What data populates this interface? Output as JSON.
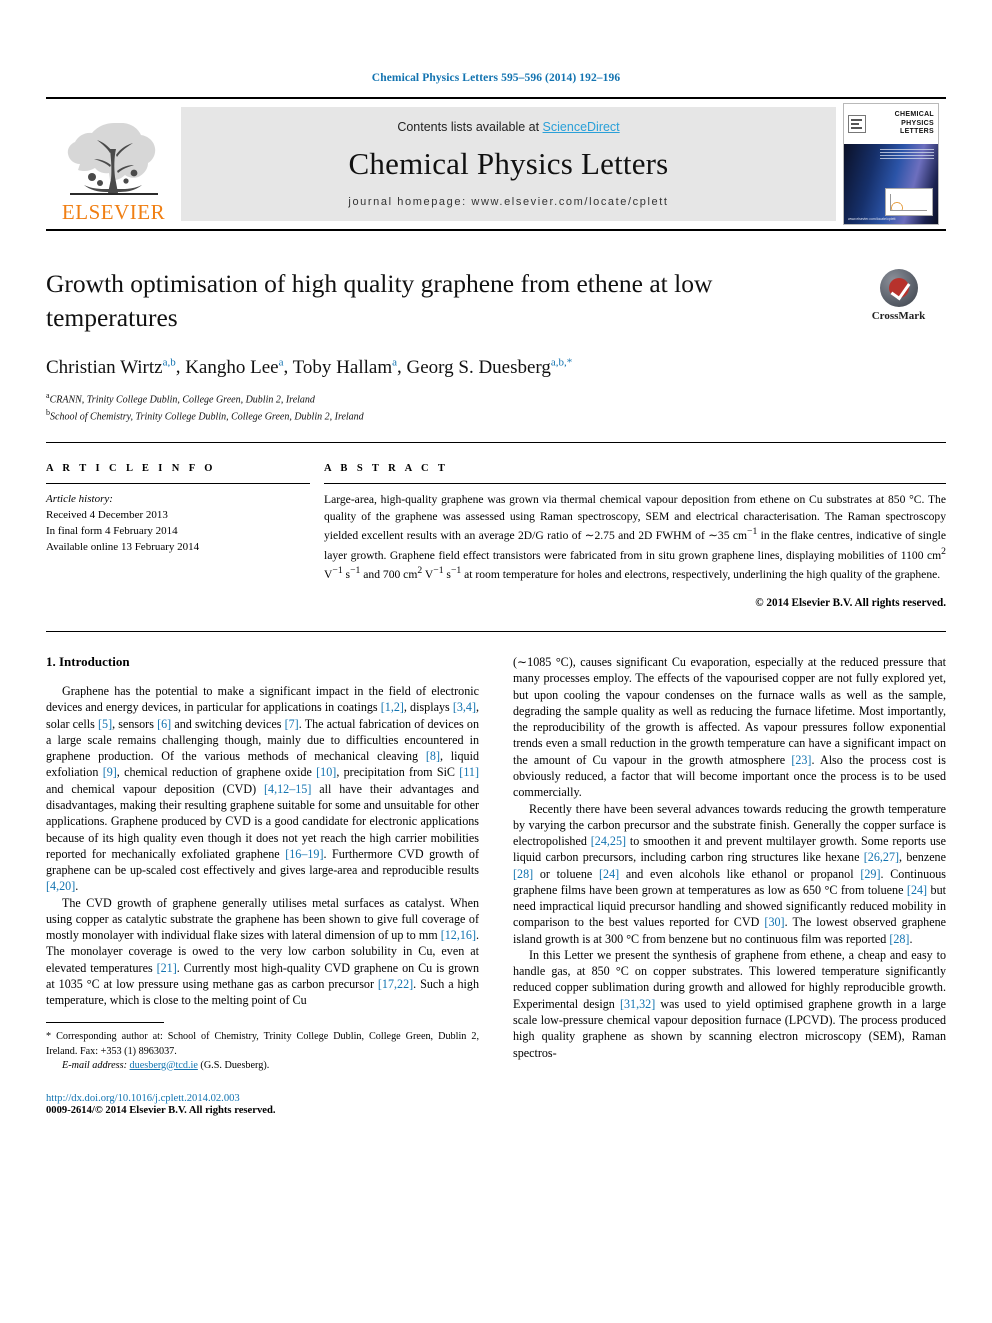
{
  "running_head": "Chemical Physics Letters 595–596 (2014) 192–196",
  "banner": {
    "contents_prefix": "Contents lists available at ",
    "sciencedirect": "ScienceDirect",
    "journal_name": "Chemical Physics Letters",
    "homepage": "journal homepage: www.elsevier.com/locate/cplett",
    "publisher": "ELSEVIER",
    "cover_title": "CHEMICAL PHYSICS LETTERS",
    "cover_footer": "www.elsevier.com/locate/cplett",
    "accent_link_color": "#1273b0",
    "sciencedirect_color": "#2aa0d8",
    "elsevier_orange": "#F07F13"
  },
  "article": {
    "title": "Growth optimisation of high quality graphene from ethene at low temperatures",
    "authors": "Christian Wirtz a,b, Kangho Lee a, Toby Hallam a, Georg S. Duesberg a,b,*",
    "author_parts": [
      {
        "name": "Christian Wirtz",
        "sup": "a,b",
        "sep": ", "
      },
      {
        "name": "Kangho Lee",
        "sup": "a",
        "sep": ", "
      },
      {
        "name": "Toby Hallam",
        "sup": "a",
        "sep": ", "
      },
      {
        "name": "Georg S. Duesberg",
        "sup": "a,b,*",
        "sep": ""
      }
    ],
    "affiliations": [
      {
        "sup": "a",
        "text": "CRANN, Trinity College Dublin, College Green, Dublin 2, Ireland"
      },
      {
        "sup": "b",
        "text": "School of Chemistry, Trinity College Dublin, College Green, Dublin 2, Ireland"
      }
    ],
    "crossmark_label": "CrossMark"
  },
  "info": {
    "heading": "A R T I C L E   I N F O",
    "history_label": "Article history:",
    "received": "Received 4 December 2013",
    "final_form": "In final form 4 February 2014",
    "available": "Available online 13 February 2014"
  },
  "abstract": {
    "heading": "A B S T R A C T",
    "text": "Large-area, high-quality graphene was grown via thermal chemical vapour deposition from ethene on Cu substrates at 850 °C. The quality of the graphene was assessed using Raman spectroscopy, SEM and electrical characterisation. The Raman spectroscopy yielded excellent results with an average 2D/G ratio of ∼2.75 and 2D FWHM of ∼35 cm−1 in the flake centres, indicative of single layer growth. Graphene field effect transistors were fabricated from in situ grown graphene lines, displaying mobilities of 1100 cm2 V−1 s−1 and 700 cm2 V−1 s−1 at room temperature for holes and electrons, respectively, underlining the high quality of the graphene.",
    "copyright": "© 2014 Elsevier B.V. All rights reserved."
  },
  "body": {
    "section_title": "1. Introduction",
    "left_paragraphs": [
      "Graphene has the potential to make a significant impact in the field of electronic devices and energy devices, in particular for applications in coatings [1,2], displays [3,4], solar cells [5], sensors [6] and switching devices [7]. The actual fabrication of devices on a large scale remains challenging though, mainly due to difficulties encountered in graphene production. Of the various methods of mechanical cleaving [8], liquid exfoliation [9], chemical reduction of graphene oxide [10], precipitation from SiC [11] and chemical vapour deposition (CVD) [4,12–15] all have their advantages and disadvantages, making their resulting graphene suitable for some and unsuitable for other applications. Graphene produced by CVD is a good candidate for electronic applications because of its high quality even though it does not yet reach the high carrier mobilities reported for mechanically exfoliated graphene [16–19]. Furthermore CVD growth of graphene can be up-scaled cost effectively and gives large-area and reproducible results [4,20].",
      "The CVD growth of graphene generally utilises metal surfaces as catalyst. When using copper as catalytic substrate the graphene has been shown to give full coverage of mostly monolayer with individual flake sizes with lateral dimension of up to mm [12,16]. The monolayer coverage is owed to the very low carbon solubility in Cu, even at elevated temperatures [21]. Currently most high-quality CVD graphene on Cu is grown at 1035 °C at low pressure using methane gas as carbon precursor [17,22]. Such a high temperature, which is close to the melting point of Cu"
    ],
    "right_paragraphs": [
      "(∼1085 °C), causes significant Cu evaporation, especially at the reduced pressure that many processes employ. The effects of the vapourised copper are not fully explored yet, but upon cooling the vapour condenses on the furnace walls as well as the sample, degrading the sample quality as well as reducing the furnace lifetime. Most importantly, the reproducibility of the growth is affected. As vapour pressures follow exponential trends even a small reduction in the growth temperature can have a significant impact on the amount of Cu vapour in the growth atmosphere [23]. Also the process cost is obviously reduced, a factor that will become important once the process is to be used commercially.",
      "Recently there have been several advances towards reducing the growth temperature by varying the carbon precursor and the substrate finish. Generally the copper surface is electropolished [24,25] to smoothen it and prevent multilayer growth. Some reports use liquid carbon precursors, including carbon ring structures like hexane [26,27], benzene [28] or toluene [24] and even alcohols like ethanol or propanol [29]. Continuous graphene films have been grown at temperatures as low as 650 °C from toluene [24] but need impractical liquid precursor handling and showed significantly reduced mobility in comparison to the best values reported for CVD [30]. The lowest observed graphene island growth is at 300 °C from benzene but no continuous film was reported [28].",
      "In this Letter we present the synthesis of graphene from ethene, a cheap and easy to handle gas, at 850 °C on copper substrates. This lowered temperature significantly reduced copper sublimation during growth and allowed for highly reproducible growth. Experimental design [31,32] was used to yield optimised graphene growth in a large scale low-pressure chemical vapour deposition furnace (LPCVD). The process produced high quality graphene as shown by scanning electron microscopy (SEM), Raman spectros-"
    ]
  },
  "footer": {
    "corresponding_marker": "*",
    "corresponding": "Corresponding author at: School of Chemistry, Trinity College Dublin, College Green, Dublin 2, Ireland. Fax: +353 (1) 8963037.",
    "email_label": "E-mail address:",
    "email": "duesberg@tcd.ie",
    "email_owner": "(G.S. Duesberg).",
    "doi": "http://dx.doi.org/10.1016/j.cplett.2014.02.003",
    "issn_line": "0009-2614/© 2014 Elsevier B.V. All rights reserved."
  }
}
